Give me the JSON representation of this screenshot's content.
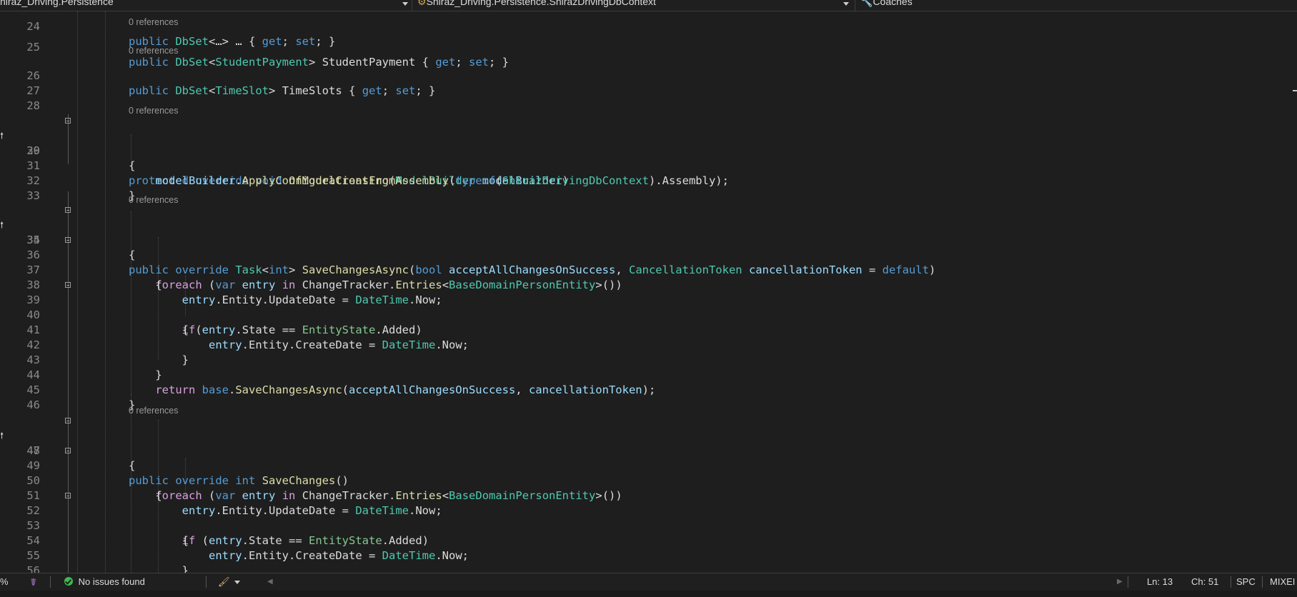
{
  "navbar": {
    "project": "hiraz_Driving.Persistence",
    "class_scope": "Shiraz_Driving.Persistence.ShirazDrivingDbContext",
    "member_scope": "Coaches"
  },
  "editor": {
    "codelens": "0 references",
    "lines": {
      "l24": "24",
      "l25": "25",
      "l26": "26",
      "l27": "27",
      "l28": "28",
      "l29": "29",
      "l30": "30",
      "l31": "31",
      "l32": "32",
      "l33": "33",
      "l34": "34",
      "l35": "35",
      "l36": "36",
      "l37": "37",
      "l38": "38",
      "l39": "39",
      "l40": "40",
      "l41": "41",
      "l42": "42",
      "l43": "43",
      "l44": "44",
      "l45": "45",
      "l46": "46",
      "l47": "47",
      "l48": "48",
      "l49": "49",
      "l50": "50",
      "l51": "51",
      "l52": "52",
      "l53": "53",
      "l54": "54",
      "l55": "55",
      "l56": "56"
    },
    "tokens": {
      "public": "public",
      "protected": "protected",
      "override": "override",
      "void": "void",
      "int": "int",
      "bool": "bool",
      "var": "var",
      "in": "in",
      "get": "get",
      "set": "set",
      "typeof": "typeof",
      "default": "default",
      "base": "base",
      "foreach": "foreach",
      "if": "if",
      "return": "return",
      "DbSet": "DbSet",
      "StudentPayment": "StudentPayment",
      "TimeSlot": "TimeSlot",
      "TimeSlots": "TimeSlots",
      "ModelBuilder": "ModelBuilder",
      "OnModelCreating": "OnModelCreating",
      "modelBuilder": "modelBuilder",
      "ApplyConfigurationsFromAssembly": "ApplyConfigurationsFromAssembly",
      "ShirazDrivingDbContext": "ShirazDrivingDbContext",
      "Assembly": "Assembly",
      "Task": "Task",
      "SaveChangesAsync": "SaveChangesAsync",
      "acceptAllChangesOnSuccess": "acceptAllChangesOnSuccess",
      "CancellationToken": "CancellationToken",
      "cancellationToken": "cancellationToken",
      "entry": "entry",
      "ChangeTracker": "ChangeTracker",
      "Entries": "Entries",
      "BaseDomainPersonEntity": "BaseDomainPersonEntity",
      "Entity": "Entity",
      "UpdateDate": "UpdateDate",
      "CreateDate": "CreateDate",
      "DateTime": "DateTime",
      "Now": "Now",
      "State": "State",
      "EntityState": "EntityState",
      "Added": "Added",
      "SaveChanges": "SaveChanges"
    }
  },
  "status": {
    "zoom_fragment": "%",
    "issues": "No issues found",
    "line": "Ln: 13",
    "col": "Ch: 51",
    "whitespace": "SPC",
    "line_endings": "MIXEI"
  },
  "icons": {
    "ok": "check-circle-icon",
    "copilot": "copilot-icon",
    "cleanup": "brush-icon",
    "nav": "chevron-icon"
  }
}
